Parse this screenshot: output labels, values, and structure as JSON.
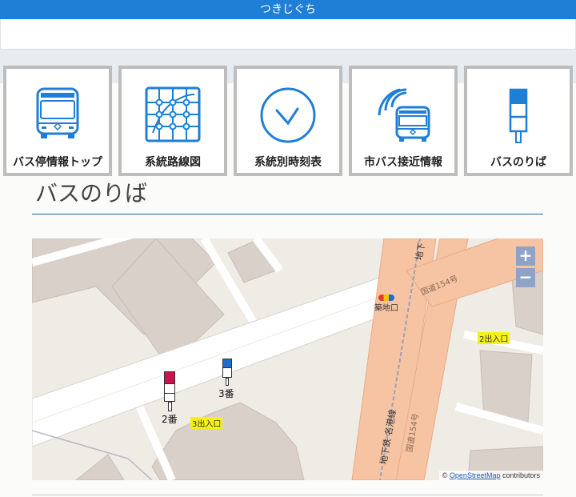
{
  "header": {
    "title": "つきじぐち"
  },
  "nav": [
    {
      "label": "バス停情報トップ",
      "icon": "bus-front-icon"
    },
    {
      "label": "系統路線図",
      "icon": "route-map-icon"
    },
    {
      "label": "系統別時刻表",
      "icon": "clock-icon"
    },
    {
      "label": "市バス接近情報",
      "icon": "bus-approach-icon"
    },
    {
      "label": "バスのりば",
      "icon": "bus-stop-pole-icon"
    }
  ],
  "page": {
    "heading": "バスのりば"
  },
  "map": {
    "zoom_in": "+",
    "zoom_out": "−",
    "station": "築地口",
    "road_label_1": "国道154号",
    "road_label_2": "国道154号",
    "subway_label": "地下鉄 名港線",
    "subway_short": "地下",
    "exit_2": "2出入口",
    "exit_3": "3出入口",
    "stop_2": "2番",
    "stop_3": "3番",
    "stop_2_color": "#c8154f",
    "stop_3_color": "#1d6fd1",
    "attribution_prefix": "© ",
    "attribution_link": "OpenStreetMap",
    "attribution_suffix": " contributors"
  }
}
